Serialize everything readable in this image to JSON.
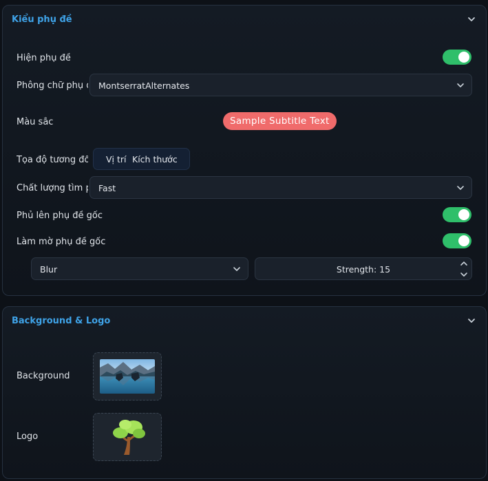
{
  "subtitle_panel": {
    "title": "Kiểu phụ đề",
    "show_subtitles": {
      "label": "Hiện phụ đề",
      "on": true
    },
    "font": {
      "label": "Phông chữ phụ đ",
      "value": "MontserratAlternates"
    },
    "color": {
      "label": "Màu sắc",
      "sample_text": "Sample Subtitle Text",
      "sample_bg": "#f06b6b"
    },
    "coords": {
      "label": "Tọa độ tương đố",
      "tab_position": "Vị trí",
      "tab_size": "Kích thước"
    },
    "quality": {
      "label": "Chất lượng tìm pl",
      "value": "Fast"
    },
    "overlay": {
      "label": "Phủ lên phụ đề gốc",
      "on": true
    },
    "blur": {
      "label": "Làm mờ phụ đề gốc",
      "on": true,
      "mode": "Blur",
      "strength_text": "Strength: 15"
    }
  },
  "background_panel": {
    "title": "Background & Logo",
    "background_label": "Background",
    "logo_label": "Logo"
  },
  "colors": {
    "accent": "#3fa3e8",
    "toggle_on": "#2fbf6a"
  }
}
